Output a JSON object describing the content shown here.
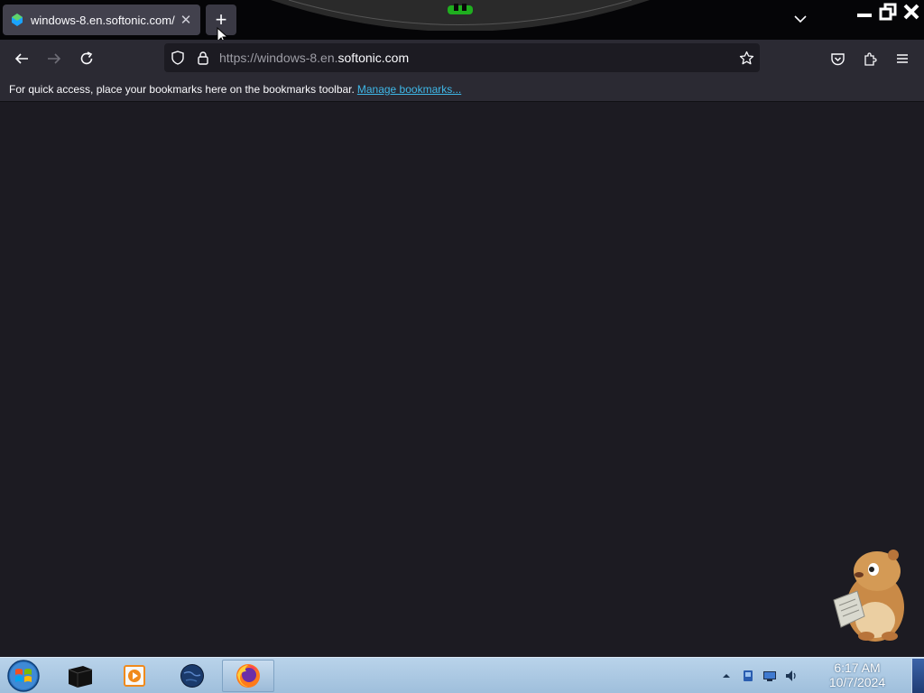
{
  "browser": {
    "tab": {
      "title": "windows-8.en.softonic.com/",
      "close_symbol": "✕"
    },
    "new_tab_symbol": "+",
    "url": {
      "dim_prefix": "https://windows-8.en.",
      "domain": "softonic.com"
    }
  },
  "bookmarks_bar": {
    "message": "For quick access, place your bookmarks here on the bookmarks toolbar.",
    "manage_link": "Manage bookmarks..."
  },
  "taskbar": {
    "clock": {
      "time": "6:17 AM",
      "date": "10/7/2024"
    },
    "apps": [
      "start-orb",
      "terminal",
      "media-player",
      "globe",
      "firefox"
    ]
  },
  "colors": {
    "content_bg": "#1c1b22",
    "toolbar_bg": "#2b2a33",
    "link": "#3fb8e8",
    "taskbar": "#b9d3ea"
  }
}
